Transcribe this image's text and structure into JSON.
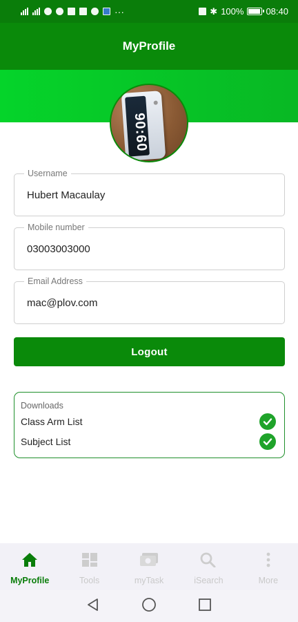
{
  "status_bar": {
    "battery": "100%",
    "battery_level": 1.0,
    "time": "08:40"
  },
  "app_bar": {
    "title": "MyProfile"
  },
  "avatar": {
    "icon": "profile-photo",
    "phone_time": "90:60"
  },
  "form": {
    "username": {
      "label": "Username",
      "value": "Hubert Macaulay"
    },
    "mobile": {
      "label": "Mobile number",
      "value": "03003003000"
    },
    "email": {
      "label": "Email Address",
      "value": "mac@plov.com"
    }
  },
  "logout": {
    "label": "Logout"
  },
  "downloads": {
    "title": "Downloads",
    "items": [
      {
        "label": "Class Arm List",
        "icon": "check-circle-icon"
      },
      {
        "label": "Subject List",
        "icon": "check-circle-icon"
      }
    ]
  },
  "bottom_nav": {
    "items": [
      {
        "label": "MyProfile",
        "icon": "home-icon",
        "active": true
      },
      {
        "label": "Tools",
        "icon": "grid-icon",
        "active": false
      },
      {
        "label": "myTask",
        "icon": "task-icon",
        "active": false
      },
      {
        "label": "iSearch",
        "icon": "search-icon",
        "active": false
      },
      {
        "label": "More",
        "icon": "more-vertical-icon",
        "active": false
      }
    ]
  },
  "colors": {
    "primary": "#0a8a0a",
    "header_band": "#05d42a",
    "check": "#1fa32a",
    "inactive": "#c9c9c9"
  }
}
